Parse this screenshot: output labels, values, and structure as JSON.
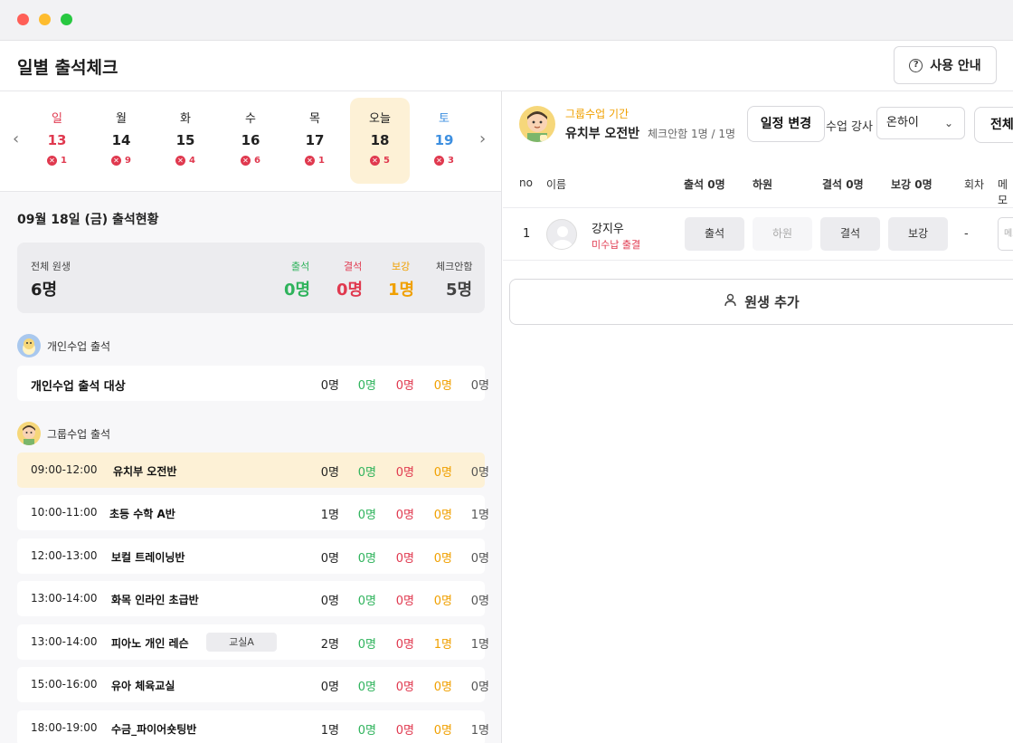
{
  "header": {
    "title": "일별 출석체크",
    "guide_label": "사용 안내"
  },
  "calendar": {
    "days": [
      {
        "name": "일",
        "date": "13",
        "absent": "1"
      },
      {
        "name": "월",
        "date": "14",
        "absent": "9"
      },
      {
        "name": "화",
        "date": "15",
        "absent": "4"
      },
      {
        "name": "수",
        "date": "16",
        "absent": "6"
      },
      {
        "name": "목",
        "date": "17",
        "absent": "1"
      },
      {
        "name": "오늘",
        "date": "18",
        "absent": "5"
      },
      {
        "name": "토",
        "date": "19",
        "absent": "3"
      }
    ]
  },
  "status": {
    "title": "09월 18일 (금) 출석현황",
    "total_label": "전체 원생",
    "total_value": "6명",
    "attend_label": "출석",
    "attend_value": "0명",
    "absent_label": "결석",
    "absent_value": "0명",
    "makeup_label": "보강",
    "makeup_value": "1명",
    "unchecked_label": "체크안함",
    "unchecked_value": "5명"
  },
  "individual": {
    "section_label": "개인수업 출석",
    "row": {
      "name": "개인수업 출석 대상",
      "total": "0명",
      "attend": "0명",
      "absent": "0명",
      "makeup": "0명",
      "unchecked": "0명"
    }
  },
  "group": {
    "section_label": "그룹수업 출석",
    "rows": [
      {
        "time": "09:00-12:00",
        "name": "유치부 오전반",
        "room": "",
        "total": "0명",
        "attend": "0명",
        "absent": "0명",
        "makeup": "0명",
        "unchecked": "0명"
      },
      {
        "time": "10:00-11:00",
        "name": "초등 수학 A반",
        "room": "",
        "total": "1명",
        "attend": "0명",
        "absent": "0명",
        "makeup": "0명",
        "unchecked": "1명"
      },
      {
        "time": "12:00-13:00",
        "name": "보컬 트레이닝반",
        "room": "",
        "total": "0명",
        "attend": "0명",
        "absent": "0명",
        "makeup": "0명",
        "unchecked": "0명"
      },
      {
        "time": "13:00-14:00",
        "name": "화목 인라인 초급반",
        "room": "",
        "total": "0명",
        "attend": "0명",
        "absent": "0명",
        "makeup": "0명",
        "unchecked": "0명"
      },
      {
        "time": "13:00-14:00",
        "name": "피아노 개인 레슨",
        "room": "교실A",
        "total": "2명",
        "attend": "0명",
        "absent": "0명",
        "makeup": "1명",
        "unchecked": "1명"
      },
      {
        "time": "15:00-16:00",
        "name": "유아 체육교실",
        "room": "",
        "total": "0명",
        "attend": "0명",
        "absent": "0명",
        "makeup": "0명",
        "unchecked": "0명"
      },
      {
        "time": "18:00-19:00",
        "name": "수금_파이어숏팅반",
        "room": "",
        "total": "1명",
        "attend": "0명",
        "absent": "0명",
        "makeup": "0명",
        "unchecked": "1명"
      }
    ]
  },
  "detail": {
    "period_label": "그룹수업 기간",
    "group_name": "유치부 오전반",
    "check_status": "체크안함 1명 / 1명",
    "schedule_button": "일정 변경",
    "teacher_label": "수업 강사",
    "teacher_value": "온하이",
    "all_button": "전체",
    "columns": {
      "no": "no",
      "name": "이름",
      "attend": "출석 0명",
      "leave": "하원",
      "absent": "결석 0명",
      "makeup": "보강 0명",
      "session": "회차",
      "memo": "메모"
    },
    "students": [
      {
        "no": "1",
        "name": "강지우",
        "fee": "미수납 출결",
        "attend": "출석",
        "leave": "하원",
        "absent": "결석",
        "makeup": "보강",
        "session": "-",
        "memo_placeholder": "메모"
      }
    ],
    "add_button": "원생 추가"
  },
  "colors": {
    "attend": "#2fb35c",
    "absent": "#e0394f",
    "makeup": "#f0a000",
    "leave": "#3d8fe0",
    "today_bg": "#fdf1d6"
  }
}
